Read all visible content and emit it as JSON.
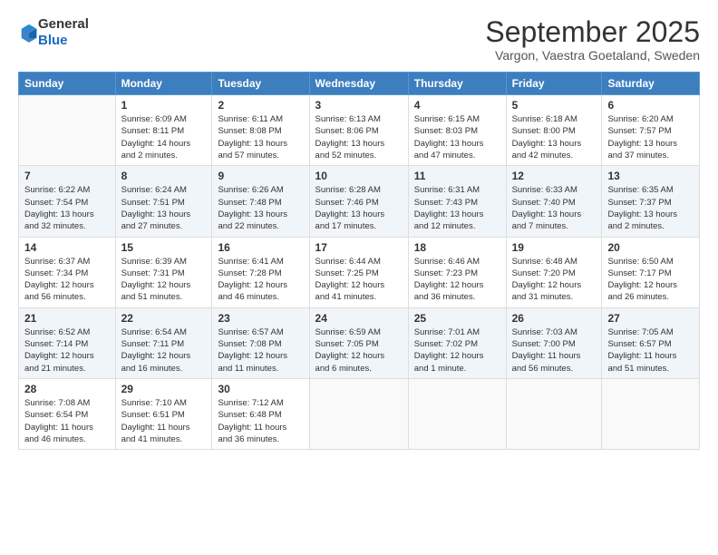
{
  "logo": {
    "line1": "General",
    "line2": "Blue"
  },
  "header": {
    "title": "September 2025",
    "location": "Vargon, Vaestra Goetaland, Sweden"
  },
  "weekdays": [
    "Sunday",
    "Monday",
    "Tuesday",
    "Wednesday",
    "Thursday",
    "Friday",
    "Saturday"
  ],
  "weeks": [
    [
      {
        "day": "",
        "info": ""
      },
      {
        "day": "1",
        "info": "Sunrise: 6:09 AM\nSunset: 8:11 PM\nDaylight: 14 hours\nand 2 minutes."
      },
      {
        "day": "2",
        "info": "Sunrise: 6:11 AM\nSunset: 8:08 PM\nDaylight: 13 hours\nand 57 minutes."
      },
      {
        "day": "3",
        "info": "Sunrise: 6:13 AM\nSunset: 8:06 PM\nDaylight: 13 hours\nand 52 minutes."
      },
      {
        "day": "4",
        "info": "Sunrise: 6:15 AM\nSunset: 8:03 PM\nDaylight: 13 hours\nand 47 minutes."
      },
      {
        "day": "5",
        "info": "Sunrise: 6:18 AM\nSunset: 8:00 PM\nDaylight: 13 hours\nand 42 minutes."
      },
      {
        "day": "6",
        "info": "Sunrise: 6:20 AM\nSunset: 7:57 PM\nDaylight: 13 hours\nand 37 minutes."
      }
    ],
    [
      {
        "day": "7",
        "info": "Sunrise: 6:22 AM\nSunset: 7:54 PM\nDaylight: 13 hours\nand 32 minutes."
      },
      {
        "day": "8",
        "info": "Sunrise: 6:24 AM\nSunset: 7:51 PM\nDaylight: 13 hours\nand 27 minutes."
      },
      {
        "day": "9",
        "info": "Sunrise: 6:26 AM\nSunset: 7:48 PM\nDaylight: 13 hours\nand 22 minutes."
      },
      {
        "day": "10",
        "info": "Sunrise: 6:28 AM\nSunset: 7:46 PM\nDaylight: 13 hours\nand 17 minutes."
      },
      {
        "day": "11",
        "info": "Sunrise: 6:31 AM\nSunset: 7:43 PM\nDaylight: 13 hours\nand 12 minutes."
      },
      {
        "day": "12",
        "info": "Sunrise: 6:33 AM\nSunset: 7:40 PM\nDaylight: 13 hours\nand 7 minutes."
      },
      {
        "day": "13",
        "info": "Sunrise: 6:35 AM\nSunset: 7:37 PM\nDaylight: 13 hours\nand 2 minutes."
      }
    ],
    [
      {
        "day": "14",
        "info": "Sunrise: 6:37 AM\nSunset: 7:34 PM\nDaylight: 12 hours\nand 56 minutes."
      },
      {
        "day": "15",
        "info": "Sunrise: 6:39 AM\nSunset: 7:31 PM\nDaylight: 12 hours\nand 51 minutes."
      },
      {
        "day": "16",
        "info": "Sunrise: 6:41 AM\nSunset: 7:28 PM\nDaylight: 12 hours\nand 46 minutes."
      },
      {
        "day": "17",
        "info": "Sunrise: 6:44 AM\nSunset: 7:25 PM\nDaylight: 12 hours\nand 41 minutes."
      },
      {
        "day": "18",
        "info": "Sunrise: 6:46 AM\nSunset: 7:23 PM\nDaylight: 12 hours\nand 36 minutes."
      },
      {
        "day": "19",
        "info": "Sunrise: 6:48 AM\nSunset: 7:20 PM\nDaylight: 12 hours\nand 31 minutes."
      },
      {
        "day": "20",
        "info": "Sunrise: 6:50 AM\nSunset: 7:17 PM\nDaylight: 12 hours\nand 26 minutes."
      }
    ],
    [
      {
        "day": "21",
        "info": "Sunrise: 6:52 AM\nSunset: 7:14 PM\nDaylight: 12 hours\nand 21 minutes."
      },
      {
        "day": "22",
        "info": "Sunrise: 6:54 AM\nSunset: 7:11 PM\nDaylight: 12 hours\nand 16 minutes."
      },
      {
        "day": "23",
        "info": "Sunrise: 6:57 AM\nSunset: 7:08 PM\nDaylight: 12 hours\nand 11 minutes."
      },
      {
        "day": "24",
        "info": "Sunrise: 6:59 AM\nSunset: 7:05 PM\nDaylight: 12 hours\nand 6 minutes."
      },
      {
        "day": "25",
        "info": "Sunrise: 7:01 AM\nSunset: 7:02 PM\nDaylight: 12 hours\nand 1 minute."
      },
      {
        "day": "26",
        "info": "Sunrise: 7:03 AM\nSunset: 7:00 PM\nDaylight: 11 hours\nand 56 minutes."
      },
      {
        "day": "27",
        "info": "Sunrise: 7:05 AM\nSunset: 6:57 PM\nDaylight: 11 hours\nand 51 minutes."
      }
    ],
    [
      {
        "day": "28",
        "info": "Sunrise: 7:08 AM\nSunset: 6:54 PM\nDaylight: 11 hours\nand 46 minutes."
      },
      {
        "day": "29",
        "info": "Sunrise: 7:10 AM\nSunset: 6:51 PM\nDaylight: 11 hours\nand 41 minutes."
      },
      {
        "day": "30",
        "info": "Sunrise: 7:12 AM\nSunset: 6:48 PM\nDaylight: 11 hours\nand 36 minutes."
      },
      {
        "day": "",
        "info": ""
      },
      {
        "day": "",
        "info": ""
      },
      {
        "day": "",
        "info": ""
      },
      {
        "day": "",
        "info": ""
      }
    ]
  ]
}
